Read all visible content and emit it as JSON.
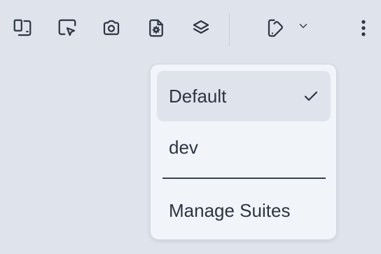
{
  "toolbar": {
    "icons": [
      "responsive-view-icon",
      "select-element-icon",
      "camera-icon",
      "document-settings-icon",
      "layers-icon",
      "theme-icon",
      "chevron-down-icon",
      "more-vertical-icon"
    ]
  },
  "dropdown": {
    "items": [
      {
        "label": "Default",
        "selected": true
      },
      {
        "label": "dev",
        "selected": false
      }
    ],
    "manage_label": "Manage Suites"
  }
}
